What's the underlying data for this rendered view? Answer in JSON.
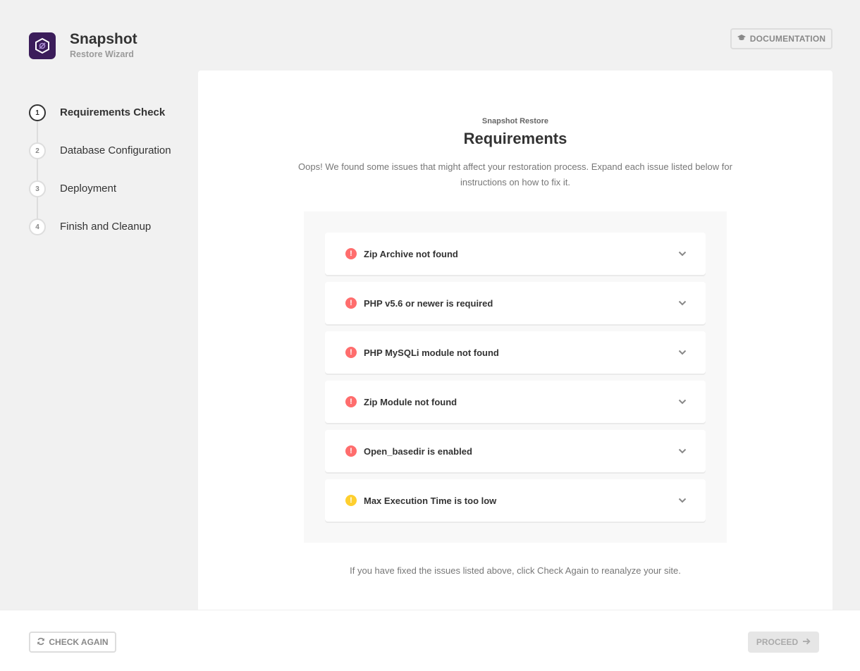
{
  "app": {
    "title": "Snapshot",
    "subtitle": "Restore Wizard",
    "documentation_label": "DOCUMENTATION",
    "logo_icon": "snapshot-logo-icon",
    "brand_color": "#3b1d5a"
  },
  "steps": [
    {
      "number": "1",
      "label": "Requirements Check",
      "active": true
    },
    {
      "number": "2",
      "label": "Database Configuration",
      "active": false
    },
    {
      "number": "3",
      "label": "Deployment",
      "active": false
    },
    {
      "number": "4",
      "label": "Finish and Cleanup",
      "active": false
    }
  ],
  "main": {
    "eyebrow": "Snapshot Restore",
    "title": "Requirements",
    "description": "Oops! We found some issues that might affect your restoration process. Expand each issue listed below for instructions on how to fix it.",
    "footer_note": "If you have fixed the issues listed above, click Check Again to reanalyze your site."
  },
  "issues": [
    {
      "label": "Zip Archive not found",
      "severity": "error",
      "icon": "!"
    },
    {
      "label": "PHP v5.6 or newer is required",
      "severity": "error",
      "icon": "!"
    },
    {
      "label": "PHP MySQLi module not found",
      "severity": "error",
      "icon": "!"
    },
    {
      "label": "Zip Module not found",
      "severity": "error",
      "icon": "!"
    },
    {
      "label": "Open_basedir is enabled",
      "severity": "error",
      "icon": "!"
    },
    {
      "label": "Max Execution Time is too low",
      "severity": "warning",
      "icon": "!"
    }
  ],
  "footer": {
    "check_again_label": "CHECK AGAIN",
    "proceed_label": "PROCEED"
  },
  "colors": {
    "error": "#ff6d6d",
    "warning": "#fecf2f"
  }
}
